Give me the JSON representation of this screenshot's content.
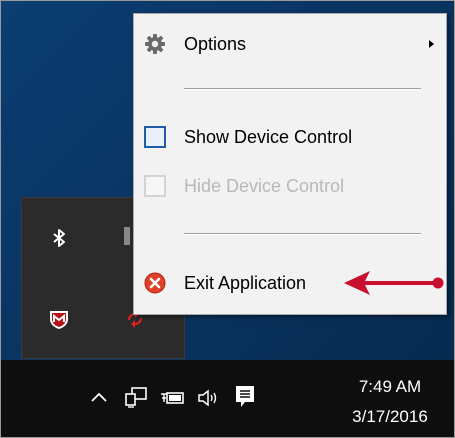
{
  "menu": {
    "items": [
      {
        "label": "Options",
        "icon": "gear-icon",
        "enabled": true,
        "submenu": true
      },
      {
        "label": "Show Device Control",
        "icon": "window-icon",
        "enabled": true
      },
      {
        "label": "Hide Device Control",
        "icon": "window-icon",
        "enabled": false
      },
      {
        "label": "Exit Application",
        "icon": "exit-icon",
        "enabled": true
      }
    ]
  },
  "annotation": {
    "arrow_color": "#c8102e",
    "points_to": "Exit Application"
  },
  "tray": {
    "icons": [
      "bluetooth-icon",
      "mcafee-icon",
      "device-control-icon"
    ]
  },
  "taskbar": {
    "icons": [
      "show-hidden-icons-chevron",
      "network-icon",
      "battery-icon",
      "volume-icon",
      "action-center-icon"
    ],
    "time": "7:49 AM",
    "date": "3/17/2016"
  },
  "colors": {
    "desktop": "#0a3563",
    "taskbar": "#0e0e0e",
    "menu": "#f2f2f2",
    "exit_red": "#e0402a"
  }
}
